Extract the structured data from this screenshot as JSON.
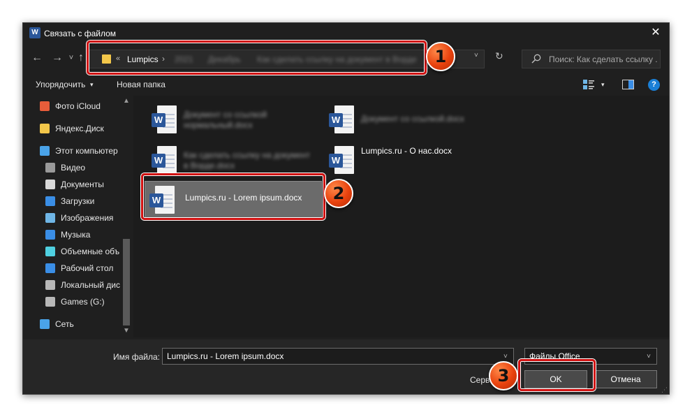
{
  "window": {
    "title": "Связать с файлом",
    "app_icon": "word-icon",
    "close_glyph": "✕"
  },
  "nav": {
    "back": "←",
    "forward": "→",
    "up_caret": "˅",
    "up": "↑",
    "address": {
      "overflow": "«",
      "current": "Lumpics",
      "separator": "›",
      "hidden_1": "2021",
      "hidden_2": "Декабрь",
      "hidden_3": "Как сделать ссылку на документ в Ворде",
      "dropdown": "˅"
    },
    "refresh": "↻",
    "search_placeholder": "Поиск: Как сделать ссылку ..."
  },
  "toolbar": {
    "organize": "Упорядочить",
    "caret": "▾",
    "new_folder": "Новая папка",
    "help": "?"
  },
  "sidebar": {
    "items": [
      {
        "label": "Фото iCloud",
        "icon": "icloud-photos-icon",
        "color": "#e85d3a"
      },
      {
        "label": "Яндекс.Диск",
        "icon": "yandex-disk-icon",
        "color": "#f3c74a"
      },
      {
        "label": "Этот компьютер",
        "icon": "computer-icon",
        "color": "#4aa3e8"
      },
      {
        "label": "Видео",
        "icon": "video-icon",
        "color": "#9a9a9a"
      },
      {
        "label": "Документы",
        "icon": "documents-icon",
        "color": "#d8d8d8"
      },
      {
        "label": "Загрузки",
        "icon": "downloads-icon",
        "color": "#3a8ee6"
      },
      {
        "label": "Изображения",
        "icon": "pictures-icon",
        "color": "#6fb6e6"
      },
      {
        "label": "Музыка",
        "icon": "music-icon",
        "color": "#3a8ee6"
      },
      {
        "label": "Объемные объ",
        "icon": "3d-objects-icon",
        "color": "#4fd0e0"
      },
      {
        "label": "Рабочий стол",
        "icon": "desktop-icon",
        "color": "#3a8ee6"
      },
      {
        "label": "Локальный дис",
        "icon": "local-disk-icon",
        "color": "#b8b8b8"
      },
      {
        "label": "Games (G:)",
        "icon": "drive-icon",
        "color": "#b8b8b8"
      },
      {
        "label": "Сеть",
        "icon": "network-icon",
        "color": "#4aa3e8"
      }
    ],
    "scroll_up": "▲",
    "scroll_down": "▼"
  },
  "files": [
    {
      "name": "Документ со ссылкой нормальный.docx",
      "blurred": true
    },
    {
      "name": "Документ со ссылкой.docx",
      "blurred": true
    },
    {
      "name": "Как сделать ссылку на документ в Ворде.docx",
      "blurred": true
    },
    {
      "name": "Lumpics.ru - О нас.docx",
      "blurred": false
    },
    {
      "name": "Lumpics.ru - Lorem ipsum.docx",
      "blurred": false,
      "selected": true
    }
  ],
  "word_badge": "W",
  "bottom": {
    "filename_label": "Имя файла:",
    "filename_value": "Lumpics.ru - Lorem ipsum.docx",
    "filetype": "Файлы Office",
    "tools": "Сервис",
    "ok": "OK",
    "cancel": "Отмена",
    "caret": "˅",
    "grip": "⋰"
  },
  "annotations": {
    "step1": "1",
    "step2": "2",
    "step3": "3",
    "accent": "#d01010"
  }
}
